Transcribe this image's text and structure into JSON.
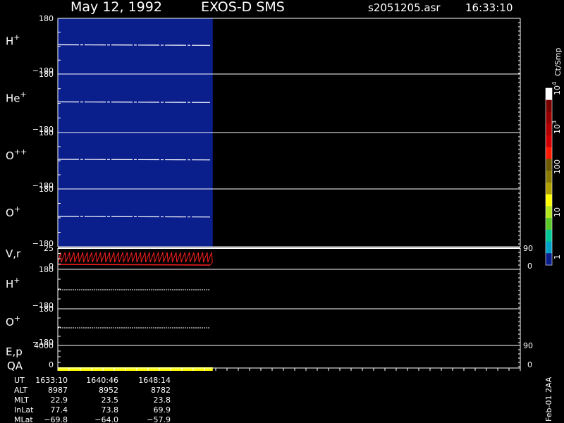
{
  "header": {
    "date": "May 12, 1992",
    "instrument": "EXOS-D SMS",
    "file": "s2051205.asr",
    "time": "16:33:10"
  },
  "colorbar": {
    "unit": "Ct/Smp",
    "labels": [
      "10^4",
      "10^3",
      "100",
      "10",
      "1"
    ],
    "colors": [
      "#ffffff",
      "#7a0000",
      "#960000",
      "#b40000",
      "#d20000",
      "#ff1a00",
      "#6b5a00",
      "#8a7a00",
      "#b0a000",
      "#ffff00",
      "#b4e61e",
      "#5ac828",
      "#00c896",
      "#00a0c8",
      "#0a1e8c"
    ]
  },
  "panels": [
    {
      "label": "H",
      "sup": "+",
      "ymax": "180",
      "ymin": "−180"
    },
    {
      "label": "He",
      "sup": "+",
      "ymax": "180",
      "ymin": "−180"
    },
    {
      "label": "O",
      "sup": "++",
      "ymax": "180",
      "ymin": "−180"
    },
    {
      "label": "O",
      "sup": "+",
      "ymax": "180",
      "ymin": "−180"
    },
    {
      "label": "V,r",
      "sup": "",
      "ymax": "25",
      "ymin": "0",
      "rmax": "90",
      "rmin": "0"
    },
    {
      "label": "H",
      "sup": "+",
      "ymax": "180",
      "ymin": "−180"
    },
    {
      "label": "O",
      "sup": "+",
      "ymax": "180",
      "ymin": "−180"
    },
    {
      "label": "E,p",
      "sub": "QA",
      "ymax": "4000",
      "ymin": "0",
      "rmax": "90",
      "rmin": "0"
    }
  ],
  "side_label": "Feb-01 2AA",
  "ephemeris": {
    "rows": [
      {
        "name": "UT",
        "values": [
          "1633:10",
          "1640:46",
          "1648:14"
        ]
      },
      {
        "name": "ALT",
        "values": [
          "8987",
          "8952",
          "8782"
        ]
      },
      {
        "name": "MLT",
        "values": [
          "22.9",
          "23.5",
          "23.8"
        ]
      },
      {
        "name": "InLat",
        "values": [
          "77.4",
          "73.8",
          "69.9"
        ]
      },
      {
        "name": "MLat",
        "values": [
          "−69.8",
          "−64.0",
          "−57.9"
        ]
      }
    ]
  },
  "chart_data": {
    "type": "heatmap",
    "title": "May 12, 1992   EXOS-D SMS",
    "x": [
      "1633:10",
      "1640:46",
      "1648:14"
    ],
    "data_fraction_of_axis": 0.335,
    "spectrogram_fill": "#0a1e8c",
    "qa_color": "#ffff00",
    "velocity_color": "#ff2020"
  }
}
